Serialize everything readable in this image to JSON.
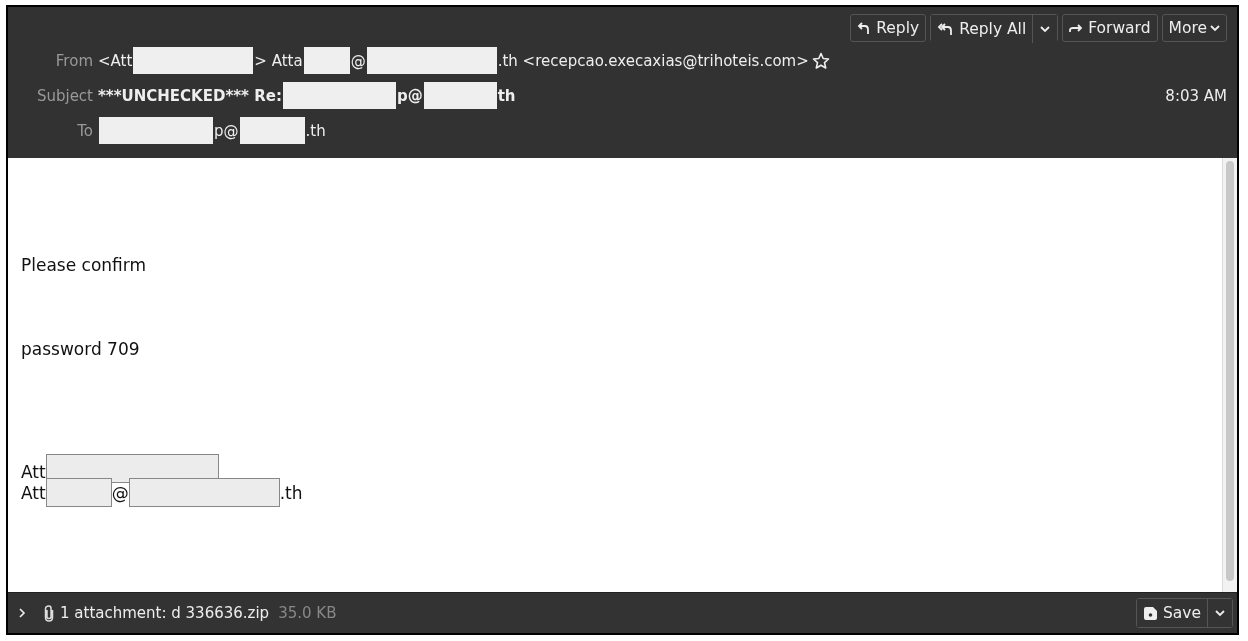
{
  "toolbar": {
    "buttons": [
      {
        "label": "Reply",
        "kind": "button"
      },
      {
        "label": "Reply All",
        "kind": "split"
      },
      {
        "label": "Forward",
        "kind": "button"
      },
      {
        "label": "More",
        "kind": "menu"
      }
    ]
  },
  "header": {
    "fields": [
      {
        "label": "From",
        "segments": [
          {
            "kind": "text",
            "text": "<Att"
          },
          {
            "kind": "redaction"
          },
          {
            "kind": "text",
            "text": "> Atta"
          },
          {
            "kind": "redaction"
          },
          {
            "kind": "text",
            "text": "@"
          },
          {
            "kind": "redaction"
          },
          {
            "kind": "text",
            "text": ".th <recepcao.execaxias@trihoteis.com>"
          }
        ],
        "starred": false
      },
      {
        "label": "Subject",
        "segments": [
          {
            "kind": "text",
            "text": "***UNCHECKED*** Re:"
          },
          {
            "kind": "redaction"
          },
          {
            "kind": "text",
            "text": "p@"
          },
          {
            "kind": "redaction"
          },
          {
            "kind": "text",
            "text": "th"
          }
        ],
        "date": "8:03 AM"
      },
      {
        "label": "To",
        "segments": [
          {
            "kind": "redaction"
          },
          {
            "kind": "text",
            "text": "p@"
          },
          {
            "kind": "redaction"
          },
          {
            "kind": "text",
            "text": ".th"
          }
        ]
      }
    ]
  },
  "body": {
    "lines": [
      [
        {
          "kind": "text",
          "text": "Please confirm"
        }
      ],
      [
        {
          "kind": "text",
          "text": "password 709"
        }
      ],
      [
        {
          "kind": "text",
          "text": "Att"
        },
        {
          "kind": "redaction"
        }
      ],
      [
        {
          "kind": "text",
          "text": "Att"
        },
        {
          "kind": "redaction"
        },
        {
          "kind": "text",
          "text": "@"
        },
        {
          "kind": "redaction"
        },
        {
          "kind": "text",
          "text": ".th"
        }
      ]
    ]
  },
  "attachments": {
    "summary": "1 attachment: d 336636.zip",
    "size": "35.0 KB",
    "expanded": false,
    "save": "Save"
  }
}
